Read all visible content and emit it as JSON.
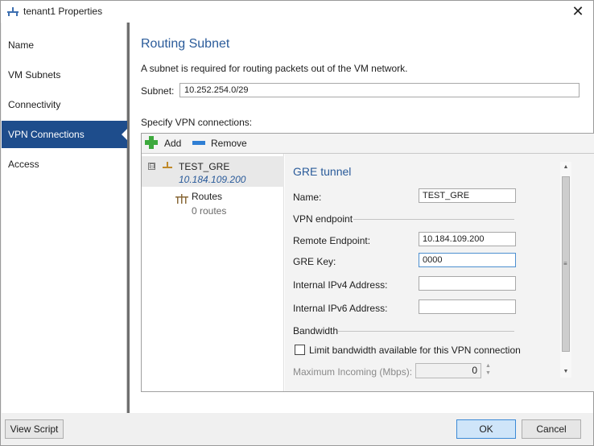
{
  "window": {
    "title": "tenant1 Properties",
    "close_symbol": "✕"
  },
  "sidebar": {
    "items": [
      {
        "label": "Name"
      },
      {
        "label": "VM Subnets"
      },
      {
        "label": "Connectivity"
      },
      {
        "label": "VPN Connections",
        "active": true
      },
      {
        "label": "Access"
      }
    ]
  },
  "main": {
    "title": "Routing Subnet",
    "description": "A subnet is required for routing packets out of the VM network.",
    "subnet_label": "Subnet:",
    "subnet_value": "10.252.254.0/29",
    "specify_label": "Specify VPN connections:"
  },
  "toolbar": {
    "add_label": "Add",
    "remove_label": "Remove"
  },
  "tree": {
    "expander": "⊟",
    "tunnel_name": "TEST_GRE",
    "tunnel_ip": "10.184.109.200",
    "routes_label": "Routes",
    "routes_count": "0 routes"
  },
  "details": {
    "title": "GRE tunnel",
    "name_label": "Name:",
    "name_value": "TEST_GRE",
    "vpn_endpoint_label": "VPN endpoint",
    "remote_endpoint_label": "Remote Endpoint:",
    "remote_endpoint_value": "10.184.109.200",
    "gre_key_label": "GRE Key:",
    "gre_key_value": "0000",
    "ipv4_label": "Internal IPv4 Address:",
    "ipv4_value": "",
    "ipv6_label": "Internal IPv6 Address:",
    "ipv6_value": "",
    "bandwidth_label": "Bandwidth",
    "limit_label": "Limit bandwidth available for this VPN connection",
    "limit_checked": false,
    "max_incoming_label": "Maximum Incoming (Mbps):",
    "max_incoming_value": "0"
  },
  "footer": {
    "view_script": "View Script",
    "ok": "OK",
    "cancel": "Cancel"
  },
  "colors": {
    "accent": "#1e4d8c",
    "heading": "#2a5b9a",
    "add_green": "#3da93d",
    "remove_blue": "#2f7fd4"
  }
}
